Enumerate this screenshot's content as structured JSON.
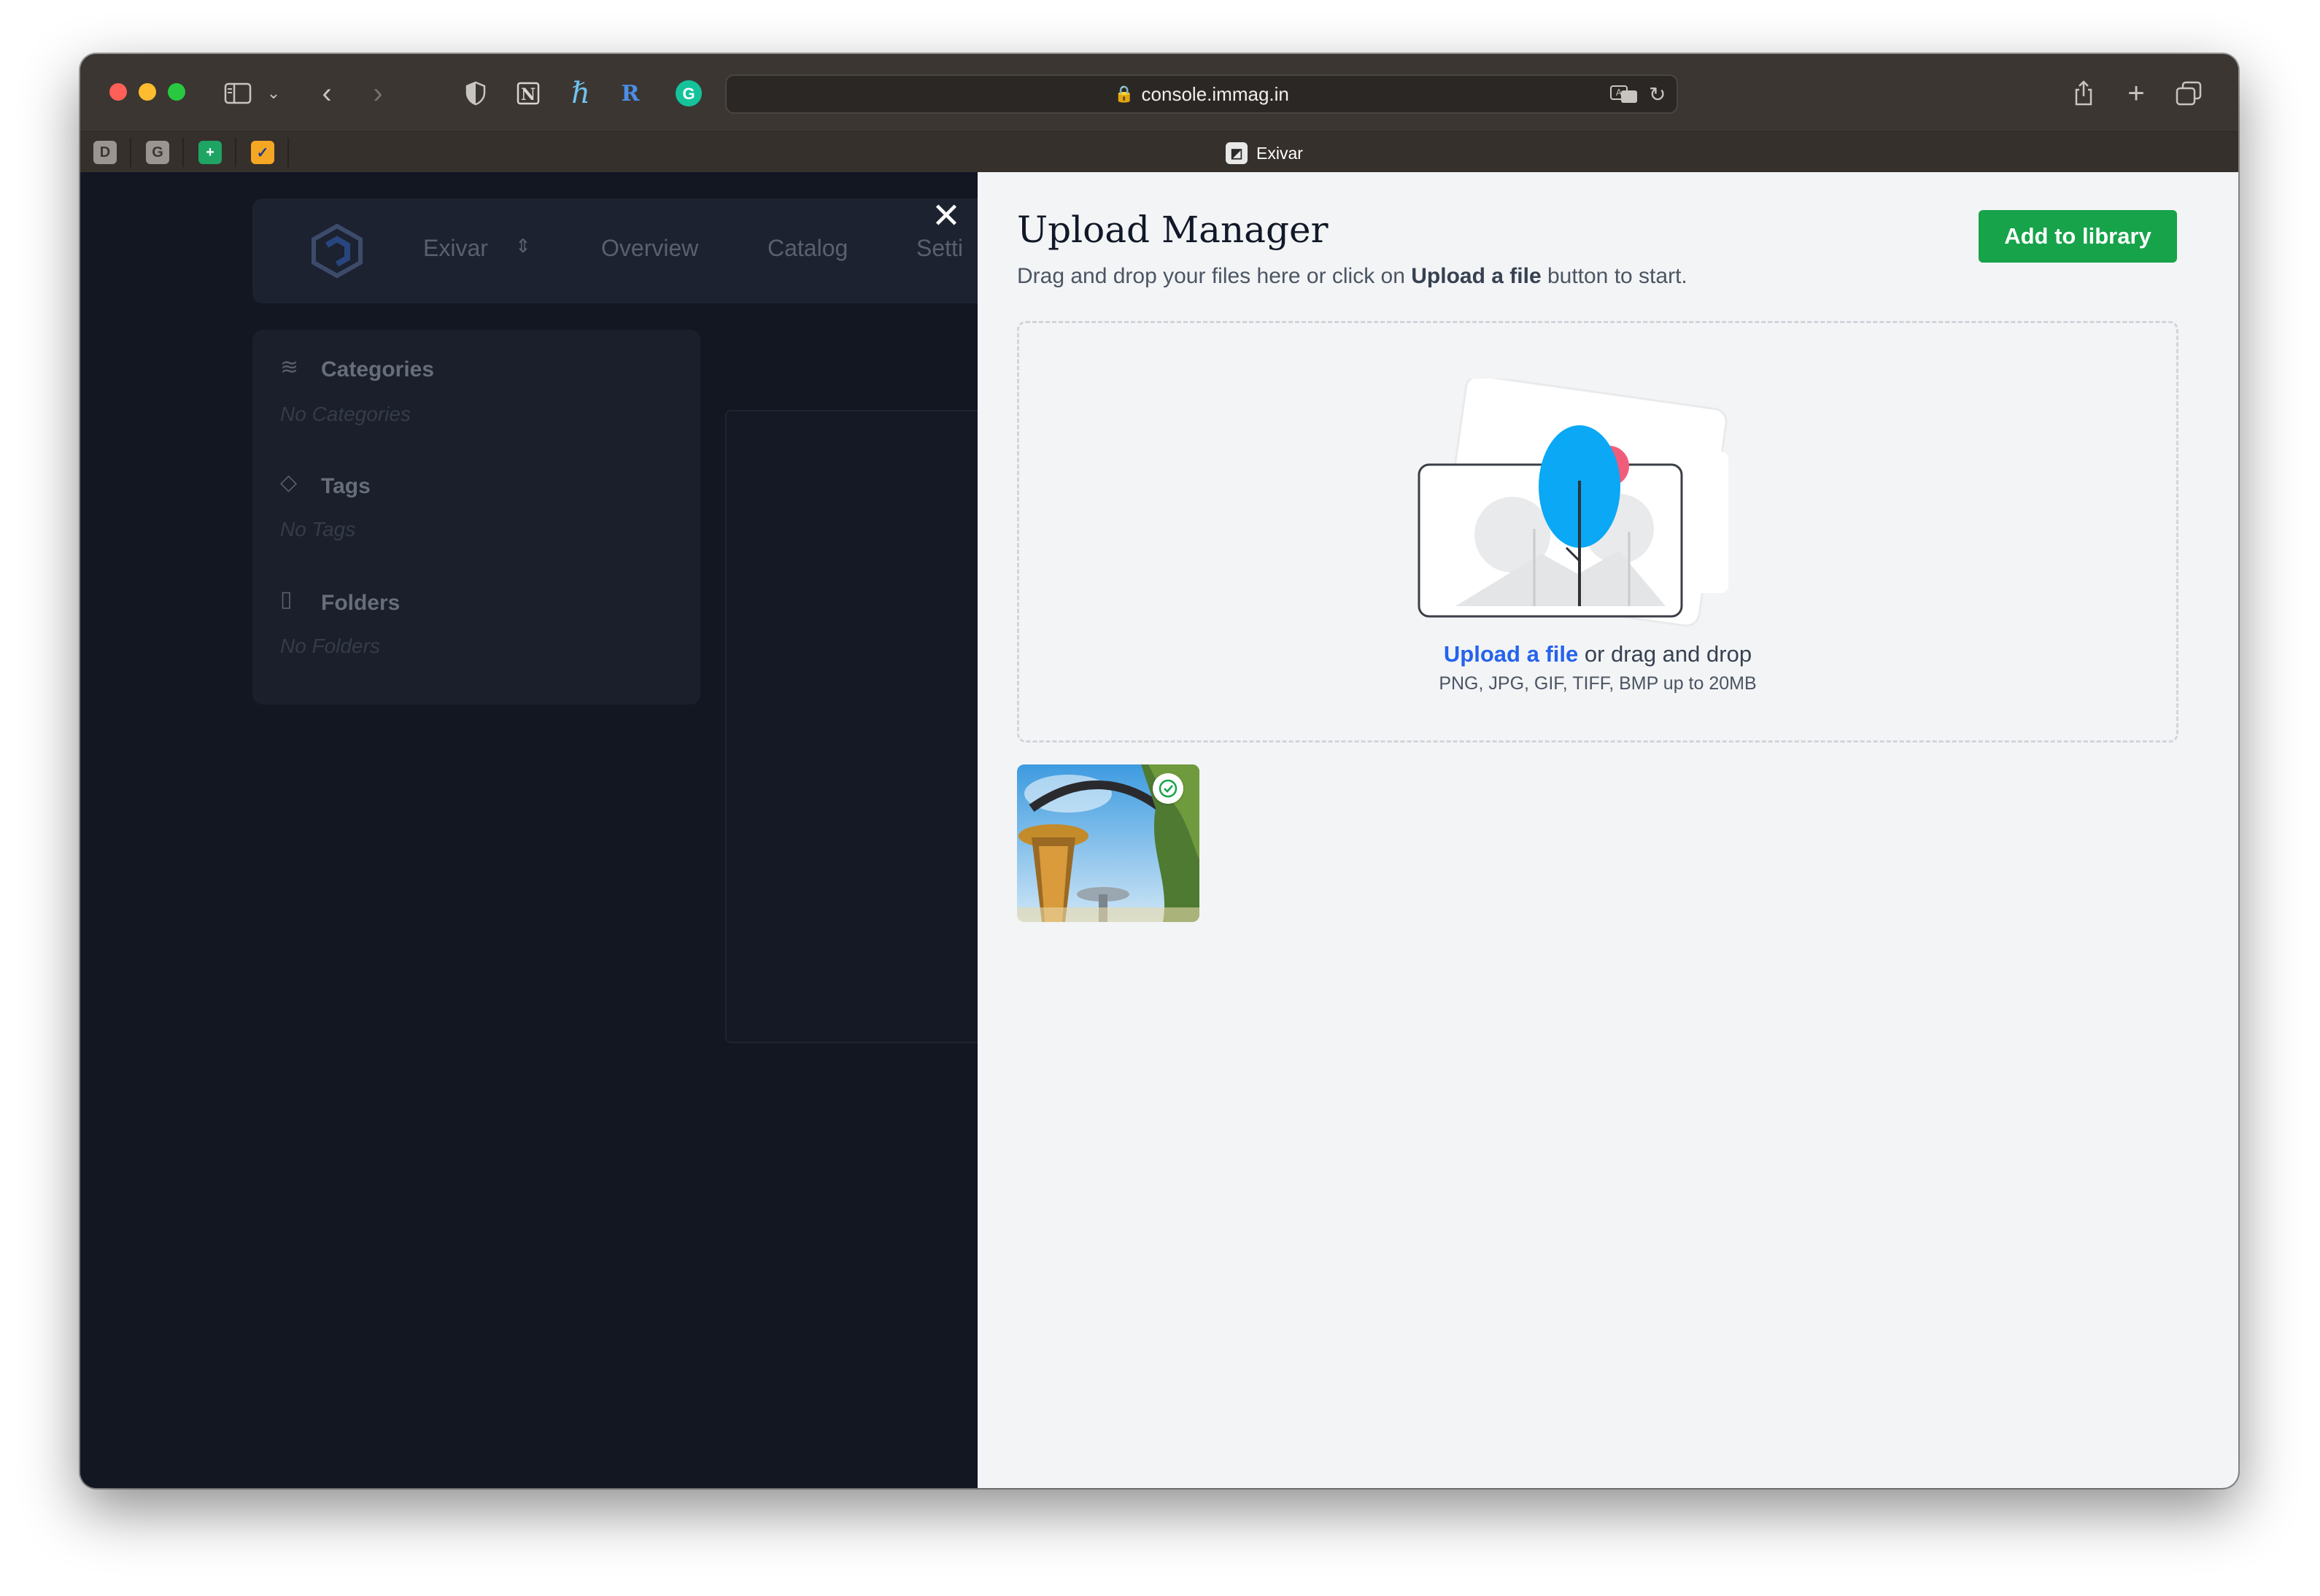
{
  "browser": {
    "url": "console.immag.in",
    "active_tab_title": "Exivar",
    "pinned_tabs": [
      "D",
      "G",
      "+",
      "✓"
    ]
  },
  "app": {
    "workspace": "Exivar",
    "nav": [
      "Overview",
      "Catalog",
      "Setti"
    ],
    "sidebar": {
      "sections": [
        {
          "title": "Categories",
          "empty": "No Categories",
          "icon": "layers-icon"
        },
        {
          "title": "Tags",
          "empty": "No Tags",
          "icon": "tag-icon"
        },
        {
          "title": "Folders",
          "empty": "No Folders",
          "icon": "folder-icon"
        }
      ]
    }
  },
  "upload_manager": {
    "title": "Upload Manager",
    "subtitle_before": "Drag and drop your files here or click on ",
    "subtitle_bold": "Upload a file",
    "subtitle_after": " button to start.",
    "add_button": "Add to library",
    "dropzone": {
      "link": "Upload a file",
      "text": " or drag and drop",
      "hint": "PNG, JPG, GIF, TIFF, BMP up to 20MB"
    },
    "uploaded": [
      {
        "status": "complete",
        "icon": "check-circle-icon"
      }
    ]
  },
  "colors": {
    "accent_green": "#16a34a",
    "link_blue": "#2563eb",
    "app_bg": "#131722"
  }
}
